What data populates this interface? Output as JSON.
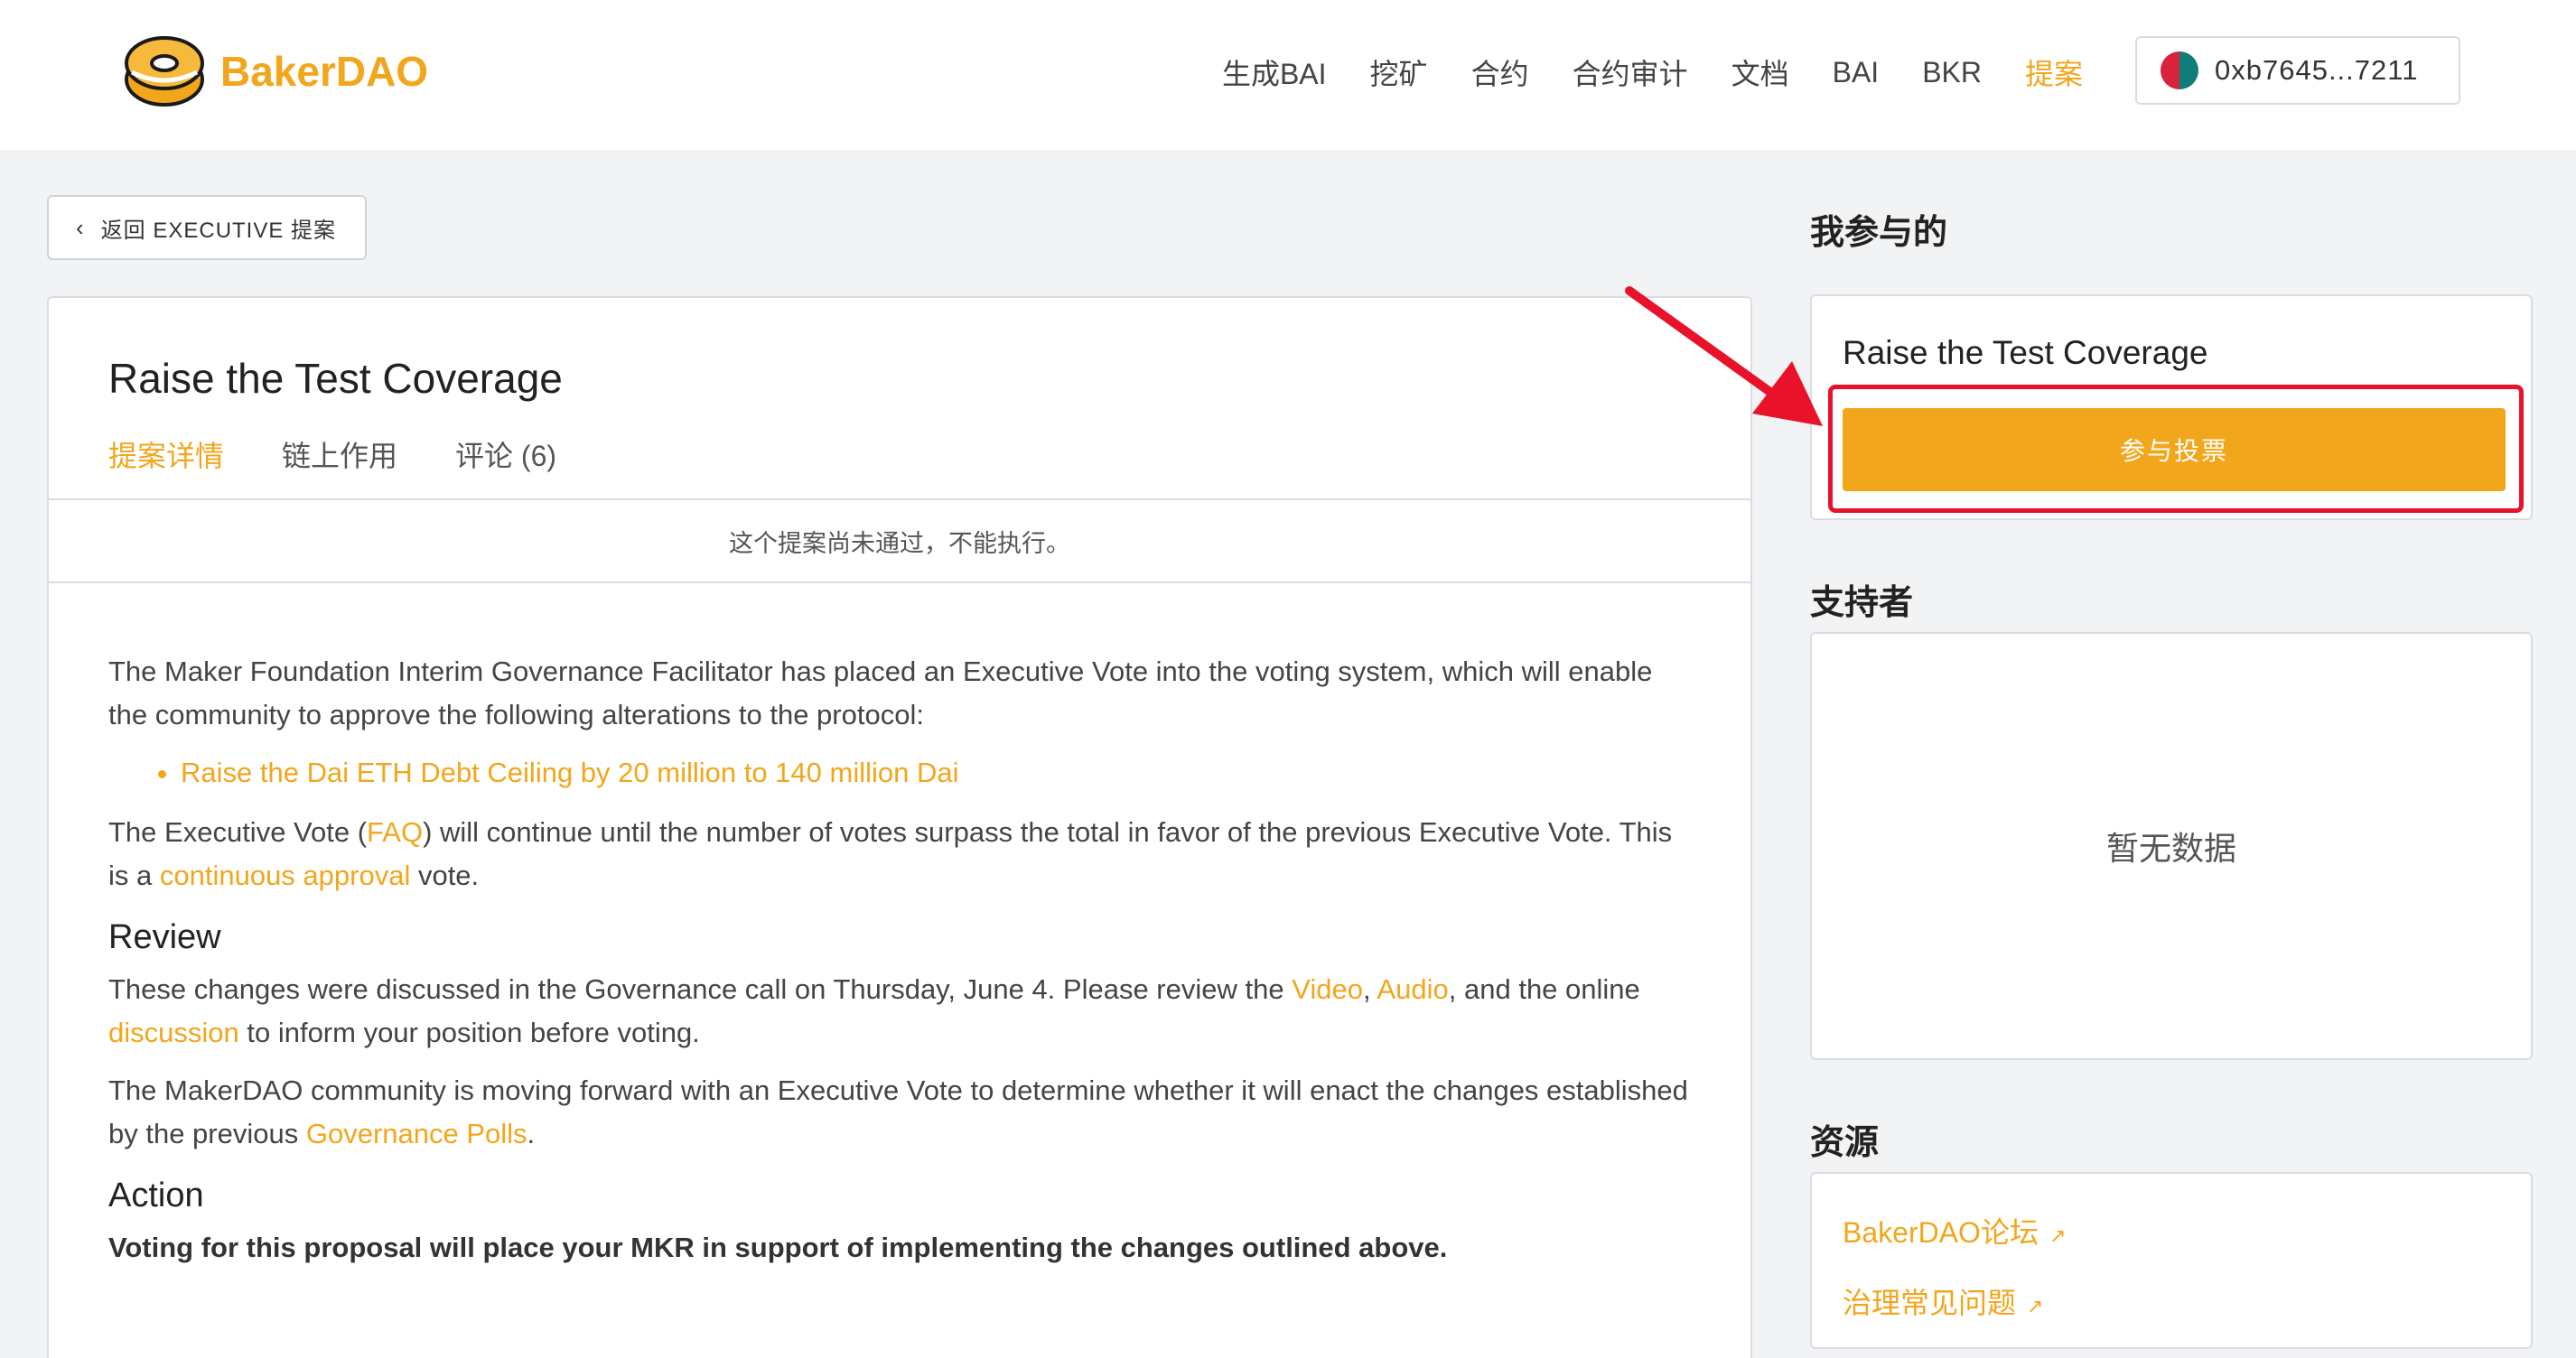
{
  "header": {
    "logo_text": "BakerDAO",
    "nav": [
      "生成BAI",
      "挖矿",
      "合约",
      "合约审计",
      "文档",
      "BAI",
      "BKR",
      "提案"
    ],
    "active_nav": "提案",
    "wallet_address": "0xb7645...7211"
  },
  "back_button": {
    "label": "返回 EXECUTIVE 提案"
  },
  "proposal": {
    "title": "Raise the Test Coverage",
    "tabs": [
      "提案详情",
      "链上作用",
      "评论 (6)"
    ],
    "notice": "这个提案尚未通过，不能执行。",
    "body": {
      "intro": "The Maker Foundation Interim Governance Facilitator has placed an Executive Vote into the voting system, which will enable the community to approve the following alterations to the protocol:",
      "bullet": "Raise the Dai ETH Debt Ceiling by 20 million to 140 million Dai",
      "exec_part1": "The Executive Vote (",
      "exec_faq": "FAQ",
      "exec_part2": ") will continue until the number of votes surpass the total in favor of the previous Executive Vote. This is a ",
      "exec_link": "continuous approval",
      "exec_part3": " vote.",
      "review_heading": "Review",
      "review_part1": "These changes were discussed in the Governance call on Thursday, June 4. Please review the ",
      "review_video": "Video",
      "review_comma": ", ",
      "review_audio": "Audio",
      "review_part2": ", and the online ",
      "review_discussion": "discussion",
      "review_part3": " to inform your position before voting.",
      "community_part1": "The MakerDAO community is moving forward with an Executive Vote to determine whether it will enact the changes established by the previous ",
      "community_link": "Governance Polls",
      "community_part2": ".",
      "action_heading": "Action",
      "action_text": "Voting for this proposal will place your MKR in support of implementing the changes outlined above."
    }
  },
  "sidebar": {
    "participated_heading": "我参与的",
    "vote_card_title": "Raise the Test Coverage",
    "vote_button": "参与投票",
    "supporters_heading": "支持者",
    "supporters_empty": "暂无数据",
    "resources_heading": "资源",
    "resources": [
      "BakerDAO论坛",
      "治理常见问题"
    ]
  },
  "colors": {
    "accent": "#f2a61b",
    "highlight": "#e8132a"
  }
}
